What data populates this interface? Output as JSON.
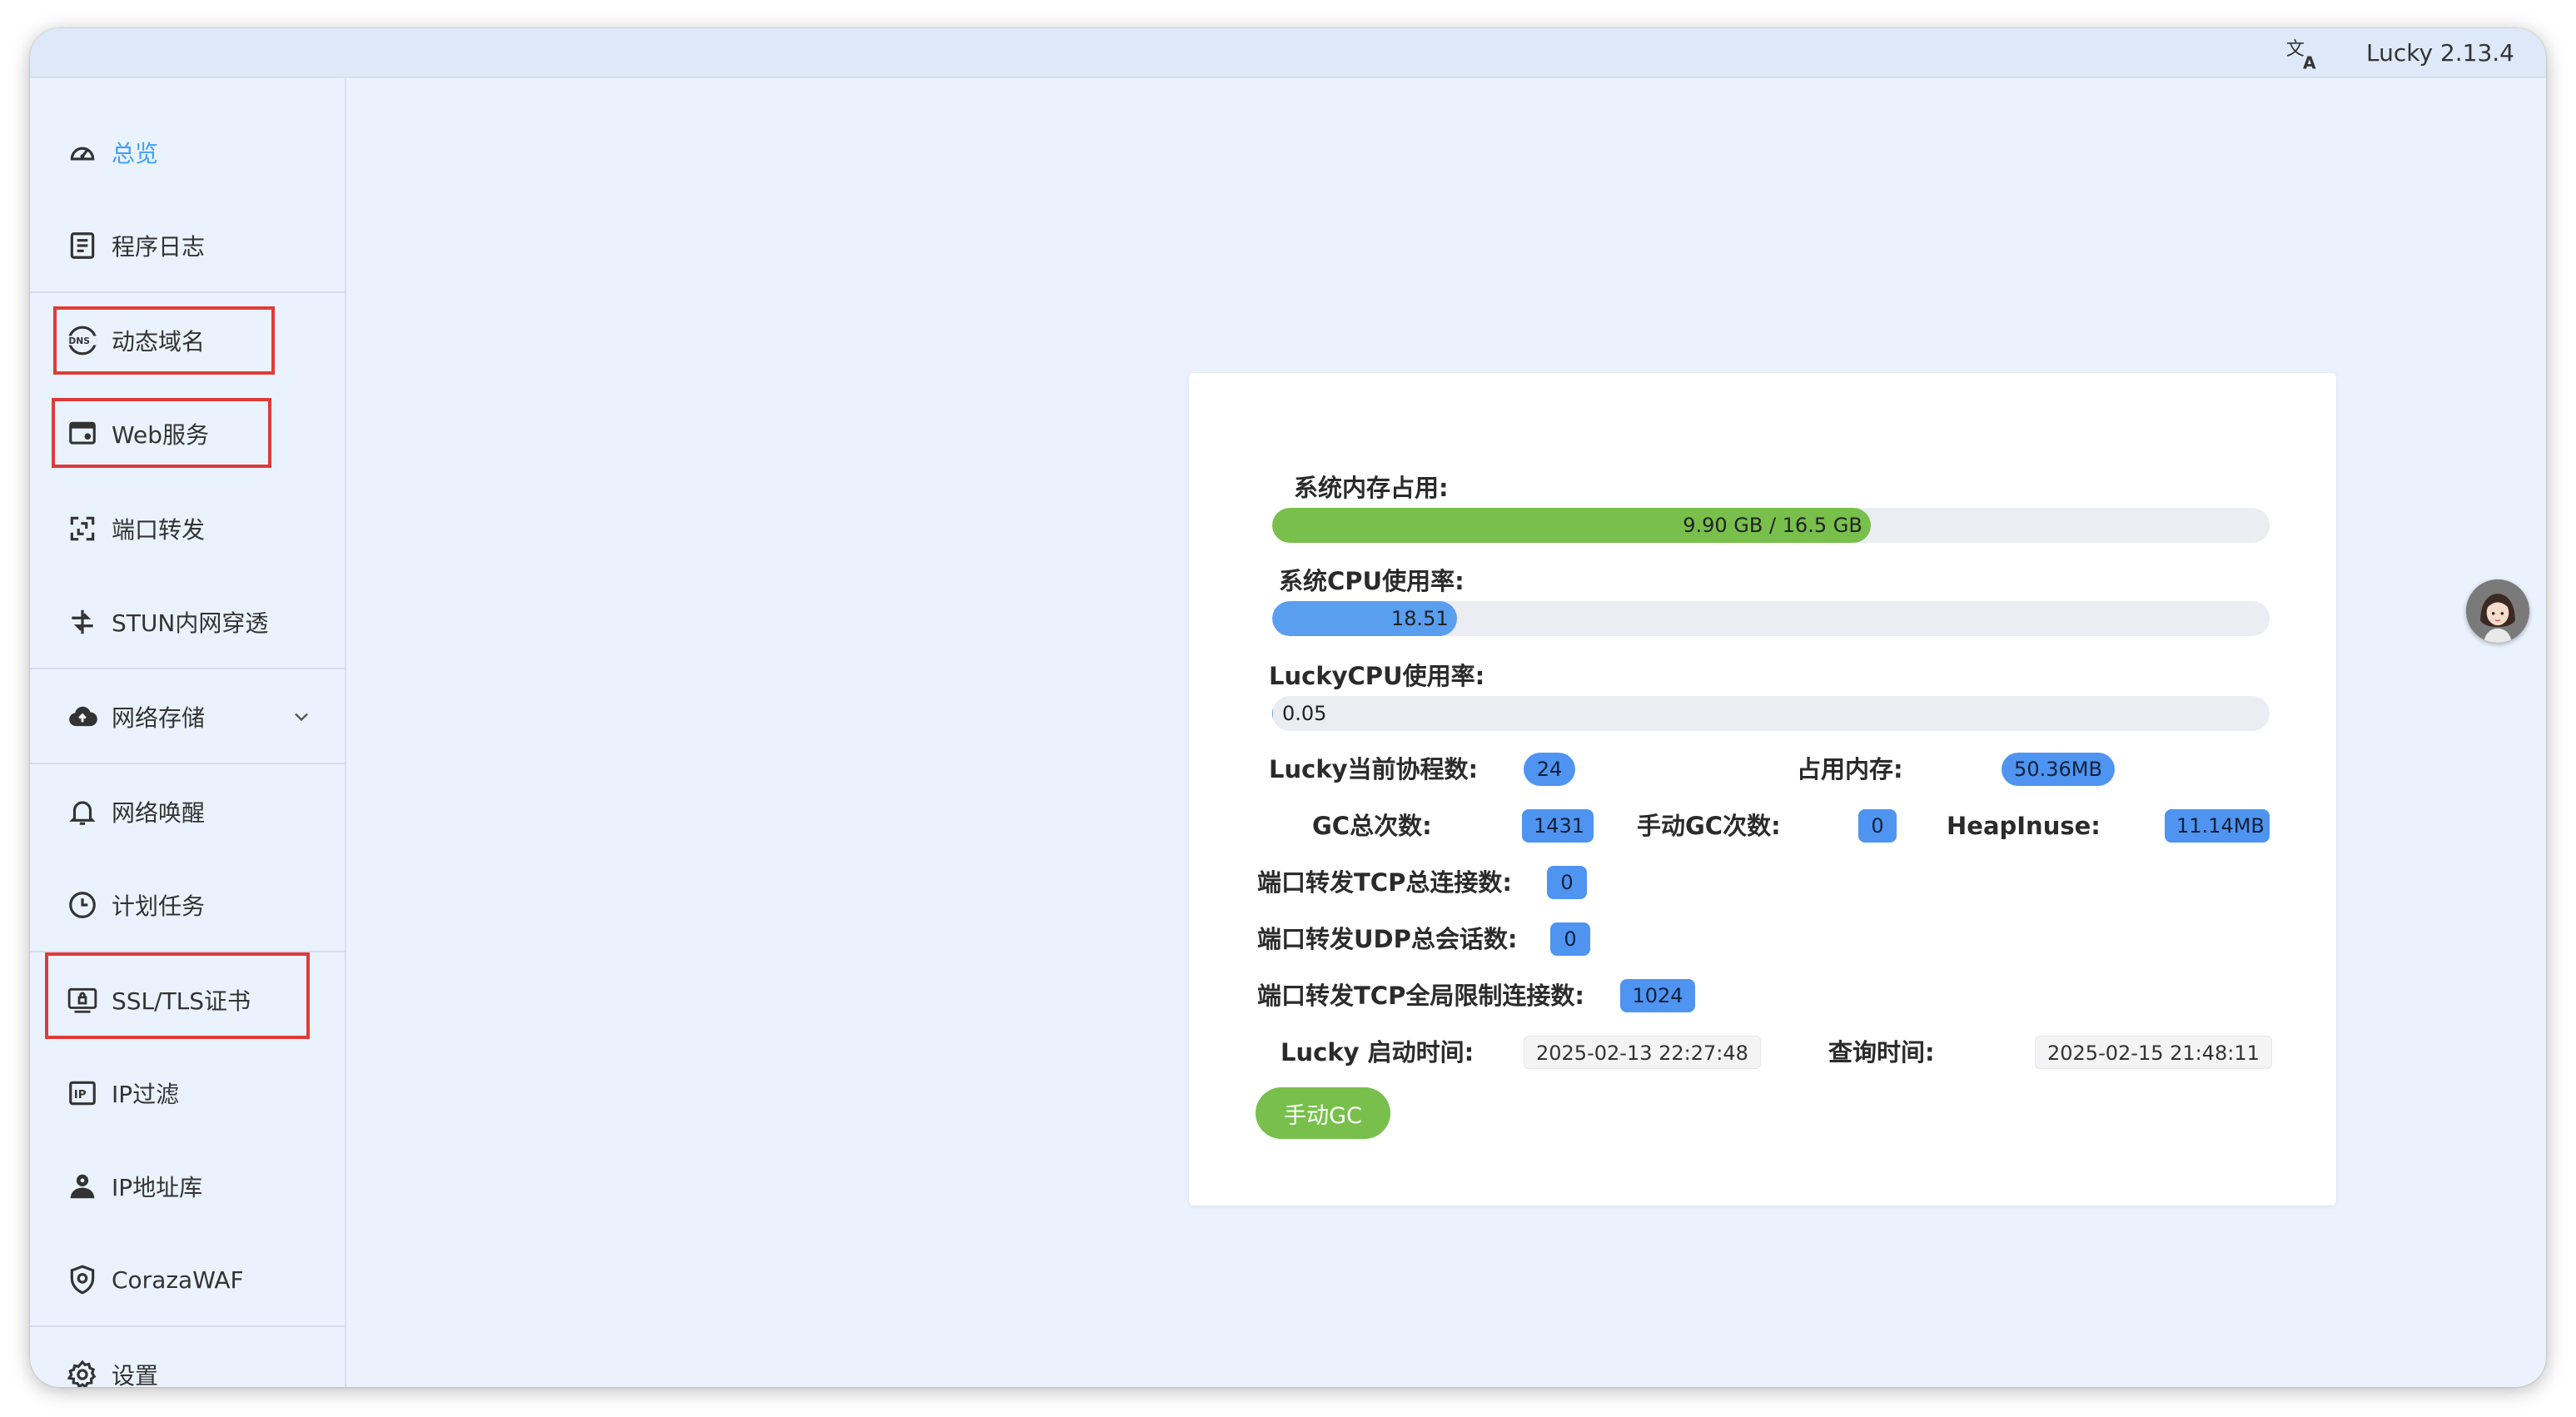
{
  "header": {
    "version": "Lucky 2.13.4",
    "language_icon": "translate-icon"
  },
  "sidebar": {
    "items": [
      {
        "label": "总览",
        "icon": "dashboard-icon",
        "active": true
      },
      {
        "label": "程序日志",
        "icon": "log-icon"
      },
      {
        "label": "动态域名",
        "icon": "dns-icon",
        "highlighted": true
      },
      {
        "label": "Web服务",
        "icon": "web-service-icon",
        "highlighted": true
      },
      {
        "label": "端口转发",
        "icon": "port-forward-icon"
      },
      {
        "label": "STUN内网穿透",
        "icon": "stun-icon"
      },
      {
        "label": "网络存储",
        "icon": "cloud-storage-icon",
        "expandable": true
      },
      {
        "label": "网络唤醒",
        "icon": "bell-icon"
      },
      {
        "label": "计划任务",
        "icon": "clock-icon"
      },
      {
        "label": "SSL/TLS证书",
        "icon": "certificate-icon",
        "highlighted": true
      },
      {
        "label": "IP过滤",
        "icon": "ip-filter-icon"
      },
      {
        "label": "IP地址库",
        "icon": "user-location-icon"
      },
      {
        "label": "CorazaWAF",
        "icon": "shield-icon"
      },
      {
        "label": "设置",
        "icon": "gear-icon"
      }
    ]
  },
  "stats": {
    "mem_label": "系统内存占用:",
    "mem_text": "9.90 GB / 16.5 GB",
    "mem_fraction": 0.6,
    "cpu_label": "系统CPU使用率:",
    "cpu_text": "18.51",
    "cpu_percent": 18.51,
    "lucky_cpu_label": "LuckyCPU使用率:",
    "lucky_cpu_text": "0.05",
    "lucky_cpu_percent": 0.05,
    "goroutines_label": "Lucky当前协程数:",
    "goroutines": "24",
    "mem_used_label": "占用内存:",
    "mem_used": "50.36MB",
    "gc_total_label": "GC总次数:",
    "gc_total": "1431",
    "manual_gc_label": "手动GC次数:",
    "manual_gc": "0",
    "heap_label": "HeapInuse:",
    "heap": "11.14MB",
    "tcp_total_label": "端口转发TCP总连接数:",
    "tcp_total": "0",
    "udp_total_label": "端口转发UDP总会话数:",
    "udp_total": "0",
    "tcp_limit_label": "端口转发TCP全局限制连接数:",
    "tcp_limit": "1024",
    "start_time_label": "Lucky 启动时间:",
    "start_time": "2025-02-13 22:27:48",
    "query_time_label": "查询时间:",
    "query_time": "2025-02-15 21:48:11",
    "gc_button": "手动GC"
  },
  "colors": {
    "highlight_border": "#e03a3a",
    "mem_bar": "#78c04b",
    "cpu_bar": "#5a9ef0",
    "badge": "#4e94f0",
    "active_nav": "#409eff"
  }
}
